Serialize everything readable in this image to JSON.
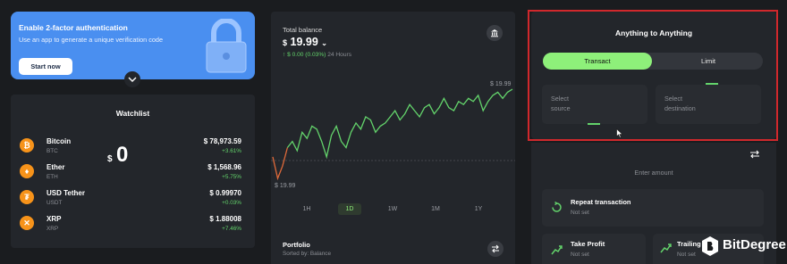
{
  "banner": {
    "title": "Enable 2-factor authentication",
    "text": "Use an app to generate a unique verification code",
    "button": "Start now"
  },
  "watchlist": {
    "title": "Watchlist",
    "items": [
      {
        "name": "Bitcoin",
        "symbol": "BTC",
        "price": "$ 78,973.59",
        "change": "+3.61%",
        "icon": "bitcoin-icon",
        "color": "#f7931a"
      },
      {
        "name": "Ether",
        "symbol": "ETH",
        "price": "$ 1,568.96",
        "change": "+5.75%",
        "icon": "ether-icon",
        "color": "#f7931a"
      },
      {
        "name": "USD Tether",
        "symbol": "USDT",
        "price": "$ 0.99970",
        "change": "+0.03%",
        "icon": "tether-icon",
        "color": "#f7931a"
      },
      {
        "name": "XRP",
        "symbol": "XRP",
        "price": "$ 1.88008",
        "change": "+7.46%",
        "icon": "xrp-icon",
        "color": "#f7931a"
      }
    ]
  },
  "balance": {
    "label": "Total balance",
    "value": "19.99",
    "currency": "$",
    "change_amount": "↑ $ 0.00 (0.03%)",
    "change_period": "24 Hours",
    "high_label": "$ 19.99",
    "low_label": "$ 19.99",
    "ranges": [
      "1H",
      "1D",
      "1W",
      "1M",
      "1Y"
    ],
    "active_range": "1D"
  },
  "chart_data": {
    "type": "line",
    "title": "",
    "xlabel": "",
    "ylabel": "",
    "series": [
      {
        "values": [
          19.975,
          19.968,
          19.972,
          19.978,
          19.98,
          19.977,
          19.983,
          19.981,
          19.985,
          19.984,
          19.98,
          19.975,
          19.982,
          19.985,
          19.98,
          19.978,
          19.983,
          19.986,
          19.984,
          19.988,
          19.987,
          19.983,
          19.985,
          19.986,
          19.988,
          19.99,
          19.987,
          19.989,
          19.992,
          19.99,
          19.988,
          19.991,
          19.992,
          19.989,
          19.991,
          19.994,
          19.991,
          19.99,
          19.993,
          19.992,
          19.994,
          19.993,
          19.995,
          19.99,
          19.993,
          19.995,
          19.996,
          19.994,
          19.996,
          19.997
        ]
      }
    ],
    "colors": {
      "up": "#63d36b",
      "down": "#e06a3a"
    }
  },
  "portfolio": {
    "title": "Portfolio",
    "subtitle": "Sorted by: Balance"
  },
  "swap": {
    "title": "Anything to Anything",
    "tab_active": "Transact",
    "tab_inactive": "Limit",
    "source": "Select\nsource",
    "destination": "Select\ndestination"
  },
  "amount": {
    "currency": "$",
    "value": "0",
    "label": "Enter amount"
  },
  "actions": {
    "repeat_title": "Repeat transaction",
    "repeat_sub": "Not set",
    "tp_title": "Take Profit",
    "tp_sub": "Not set",
    "trail_title": "Trailing",
    "trail_sub": "Not set"
  },
  "watermark": "BitDegree",
  "accent": "#8ef07a",
  "highlight_color": "#d0282c"
}
